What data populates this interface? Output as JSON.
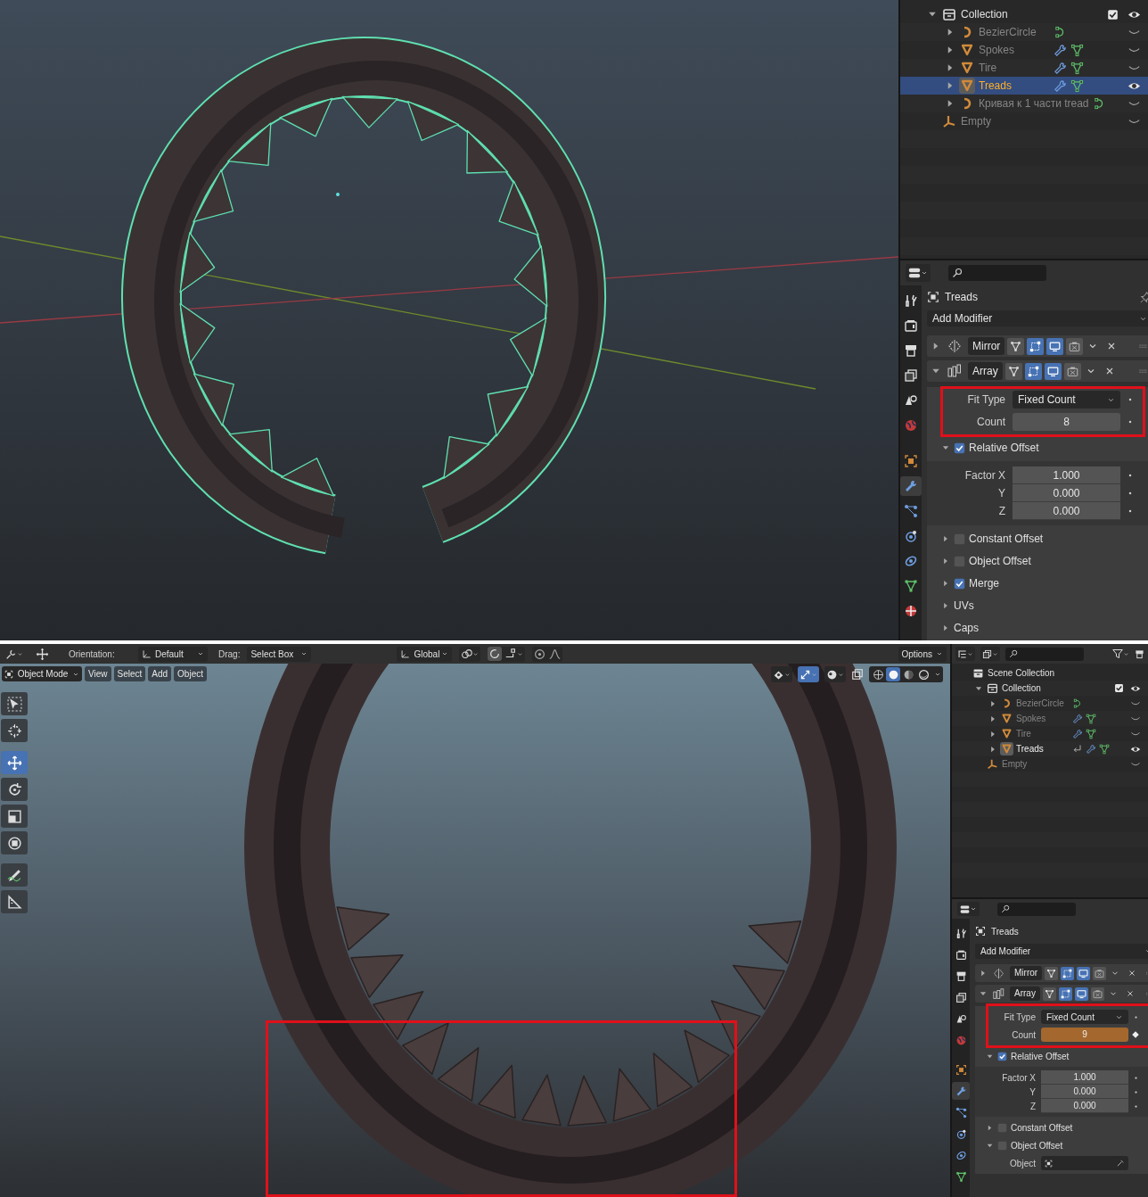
{
  "top": {
    "outliner": {
      "tree": [
        {
          "label": "Collection",
          "kind": "collection",
          "expanded": true,
          "checked": true,
          "visible": true,
          "selected": false,
          "active": false,
          "children": [
            {
              "label": "BezierCircle",
              "kind": "curve",
              "expanded": false,
              "visible": false,
              "selected": false,
              "active": false,
              "modifier": false,
              "linked": false
            },
            {
              "label": "Spokes",
              "kind": "mesh",
              "expanded": false,
              "visible": false,
              "selected": false,
              "active": false,
              "modifier": true,
              "linked": false
            },
            {
              "label": "Tire",
              "kind": "mesh",
              "expanded": false,
              "visible": false,
              "selected": false,
              "active": false,
              "modifier": true,
              "linked": false
            },
            {
              "label": "Treads",
              "kind": "mesh",
              "expanded": false,
              "visible": true,
              "selected": true,
              "active": true,
              "modifier": true,
              "linked": false
            },
            {
              "label": "Кривая к 1 части tread",
              "kind": "curve",
              "expanded": false,
              "visible": false,
              "selected": false,
              "active": false,
              "modifier": false,
              "linked": false
            }
          ]
        },
        {
          "label": "Empty",
          "kind": "empty",
          "visible": false,
          "selected": false,
          "active": false,
          "modifier": false,
          "linked": false
        }
      ]
    },
    "properties": {
      "tabs": [
        {
          "kind": "tool",
          "selected": false
        },
        {
          "kind": "render",
          "selected": false
        },
        {
          "kind": "output",
          "selected": false
        },
        {
          "kind": "view_layer",
          "selected": false
        },
        {
          "kind": "scene",
          "selected": false
        },
        {
          "kind": "world",
          "selected": false
        },
        {
          "kind": "object",
          "selected": false
        },
        {
          "kind": "modifiers",
          "selected": true
        },
        {
          "kind": "particles",
          "selected": false
        },
        {
          "kind": "physics",
          "selected": false
        },
        {
          "kind": "constraints",
          "selected": false
        },
        {
          "kind": "data",
          "selected": false
        },
        {
          "kind": "material",
          "selected": false
        }
      ],
      "object_name": "Treads",
      "add_modifier": "Add Modifier",
      "modifiers": [
        {
          "kind": "mirror",
          "name": "Mirror",
          "expanded": false,
          "toggles": [
            {
              "kind": "on_cage",
              "on": false
            },
            {
              "kind": "edit_mode",
              "on": true
            },
            {
              "kind": "viewport",
              "on": true
            },
            {
              "kind": "render",
              "on": false
            }
          ]
        },
        {
          "kind": "array",
          "name": "Array",
          "expanded": true,
          "toggles": [
            {
              "kind": "on_cage",
              "on": false
            },
            {
              "kind": "edit_mode",
              "on": true
            },
            {
              "kind": "viewport",
              "on": true
            },
            {
              "kind": "render",
              "on": false
            }
          ]
        }
      ],
      "array": {
        "fit_type": {
          "label": "Fit Type",
          "value": "Fixed Count"
        },
        "count": {
          "label": "Count",
          "value": "8",
          "keyframed": false
        },
        "relative_offset": {
          "label": "Relative Offset",
          "checked": true,
          "expanded": true
        },
        "factors": [
          {
            "label": "Factor X",
            "value": "1.000"
          },
          {
            "label": "Y",
            "value": "0.000"
          },
          {
            "label": "Z",
            "value": "0.000"
          }
        ],
        "sections": [
          {
            "label": "Constant Offset",
            "checked": false,
            "expanded": false
          },
          {
            "label": "Object Offset",
            "checked": false,
            "expanded": false
          },
          {
            "label": "Merge",
            "checked": true,
            "expanded": false
          },
          {
            "label": "UVs",
            "expanded": false
          },
          {
            "label": "Caps",
            "expanded": false
          }
        ]
      }
    }
  },
  "bottom": {
    "header": {
      "orientation_label": "Orientation:",
      "orientation": "Default",
      "drag_label": "Drag:",
      "drag": "Select Box",
      "transform": "Global",
      "options": "Options"
    },
    "viewport_header": {
      "mode": "Object Mode",
      "menus": [
        "View",
        "Select",
        "Add",
        "Object"
      ],
      "gizmos_on": true,
      "shading": [
        {
          "kind": "wireframe",
          "selected": false
        },
        {
          "kind": "solid",
          "selected": true
        },
        {
          "kind": "material",
          "selected": false
        },
        {
          "kind": "rendered",
          "selected": false
        }
      ]
    },
    "toolbar": [
      {
        "kind": "select",
        "selected": false
      },
      {
        "kind": "cursor",
        "selected": false
      },
      {
        "kind": "move",
        "selected": true
      },
      {
        "kind": "rotate",
        "selected": false
      },
      {
        "kind": "scale",
        "selected": false
      },
      {
        "kind": "transform",
        "selected": false
      },
      {
        "kind": "annotate",
        "selected": false
      },
      {
        "kind": "measure",
        "selected": false
      }
    ],
    "outliner": {
      "tree": [
        {
          "label": "Scene Collection",
          "kind": "scene_collection",
          "visible": true,
          "selected": false,
          "active": false,
          "children": [
            {
              "label": "Collection",
              "kind": "collection",
              "expanded": true,
              "checked": true,
              "visible": true,
              "selected": false,
              "active": false,
              "children": [
                {
                  "label": "BezierCircle",
                  "kind": "curve",
                  "expanded": false,
                  "visible": false,
                  "selected": false,
                  "active": false,
                  "modifier": false,
                  "linked": false
                },
                {
                  "label": "Spokes",
                  "kind": "mesh",
                  "expanded": false,
                  "visible": false,
                  "selected": false,
                  "active": false,
                  "modifier": true,
                  "linked": false
                },
                {
                  "label": "Tire",
                  "kind": "mesh",
                  "expanded": false,
                  "visible": false,
                  "selected": false,
                  "active": false,
                  "modifier": true,
                  "linked": false
                },
                {
                  "label": "Treads",
                  "kind": "mesh",
                  "expanded": false,
                  "visible": true,
                  "selected": false,
                  "active": true,
                  "modifier": true,
                  "linked": true
                }
              ]
            },
            {
              "label": "Empty",
              "kind": "empty",
              "visible": false,
              "selected": false,
              "active": false,
              "modifier": false,
              "linked": false
            }
          ]
        }
      ]
    },
    "properties": {
      "tabs": [
        {
          "kind": "tool",
          "selected": false
        },
        {
          "kind": "render",
          "selected": false
        },
        {
          "kind": "output",
          "selected": false
        },
        {
          "kind": "view_layer",
          "selected": false
        },
        {
          "kind": "scene",
          "selected": false
        },
        {
          "kind": "world",
          "selected": false
        },
        {
          "kind": "object",
          "selected": false
        },
        {
          "kind": "modifiers",
          "selected": true
        },
        {
          "kind": "particles",
          "selected": false
        },
        {
          "kind": "physics",
          "selected": false
        },
        {
          "kind": "constraints",
          "selected": false
        },
        {
          "kind": "data",
          "selected": false
        }
      ],
      "object_name": "Treads",
      "add_modifier": "Add Modifier",
      "modifiers": [
        {
          "kind": "mirror",
          "name": "Mirror",
          "expanded": false,
          "toggles": [
            {
              "kind": "on_cage",
              "on": false
            },
            {
              "kind": "edit_mode",
              "on": true
            },
            {
              "kind": "viewport",
              "on": true
            },
            {
              "kind": "render",
              "on": false
            }
          ]
        },
        {
          "kind": "array",
          "name": "Array",
          "expanded": true,
          "toggles": [
            {
              "kind": "on_cage",
              "on": false
            },
            {
              "kind": "edit_mode",
              "on": true
            },
            {
              "kind": "viewport",
              "on": true
            },
            {
              "kind": "render",
              "on": false
            }
          ]
        }
      ],
      "array": {
        "fit_type": {
          "label": "Fit Type",
          "value": "Fixed Count"
        },
        "count": {
          "label": "Count",
          "value": "9",
          "keyframed": true
        },
        "relative_offset": {
          "label": "Relative Offset",
          "checked": true,
          "expanded": true
        },
        "factors": [
          {
            "label": "Factor X",
            "value": "1.000"
          },
          {
            "label": "Y",
            "value": "0.000"
          },
          {
            "label": "Z",
            "value": "0.000"
          }
        ],
        "sections": [
          {
            "label": "Constant Offset",
            "checked": false,
            "expanded": false
          },
          {
            "label": "Object Offset",
            "checked": false,
            "expanded": true,
            "fields": [
              {
                "label": "Object"
              }
            ]
          }
        ]
      }
    }
  }
}
